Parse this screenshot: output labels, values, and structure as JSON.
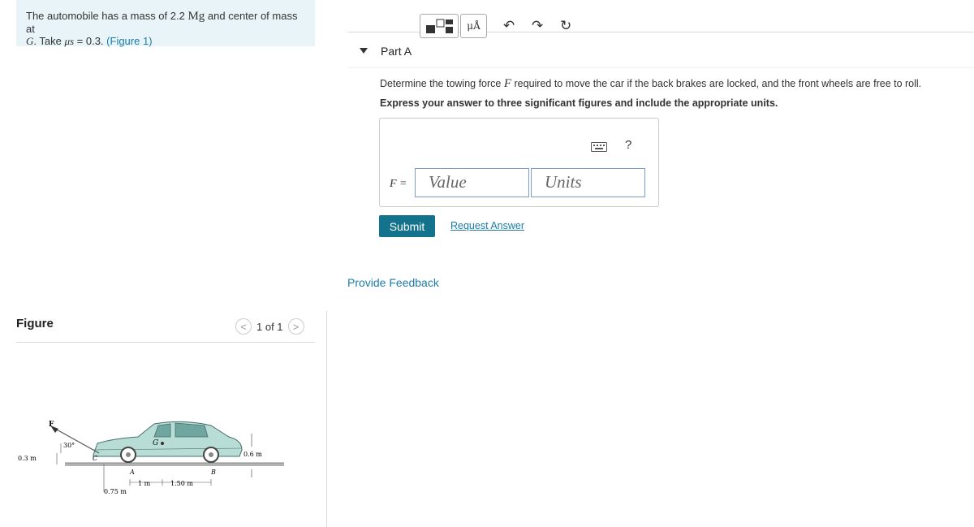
{
  "problem": {
    "text_part1": "The automobile has a mass of 2.2 ",
    "unit_mg": "Mg",
    "text_part2": " and center of mass at",
    "var_g": "G",
    "text_part3": ". Take ",
    "mu_symbol": "μs",
    "text_part4": " = 0.3. ",
    "figure_link": "(Figure 1)"
  },
  "figure": {
    "label": "Figure",
    "pager_text": "1 of 1",
    "prev_glyph": "<",
    "next_glyph": ">",
    "labels": {
      "force": "F",
      "angle": "30°",
      "height_hitch": "0.3 m",
      "point_c": "C",
      "point_a": "A",
      "point_b": "B",
      "point_g": "G",
      "height_g": "0.6 m",
      "dist_1": "1 m",
      "dist_2": "1.50 m",
      "dist_3": "0.75 m"
    }
  },
  "part_a": {
    "title": "Part A",
    "question_pre": "Determine the towing force ",
    "question_var": "F",
    "question_post": " required to move the car if the back brakes are locked, and the front wheels are free to roll.",
    "instruction": "Express your answer to three significant figures and include the appropriate units.",
    "toolbar": {
      "units_button": "μÅ",
      "help": "?"
    },
    "f_label": "F =",
    "value_placeholder": "Value",
    "units_placeholder": "Units",
    "submit": "Submit",
    "request_answer": "Request Answer"
  },
  "feedback_link": "Provide Feedback",
  "colors": {
    "accent": "#13728c",
    "link": "#1a7ca8",
    "problem_bg": "#e8f4f8",
    "car_body": "#b8ddd6"
  }
}
